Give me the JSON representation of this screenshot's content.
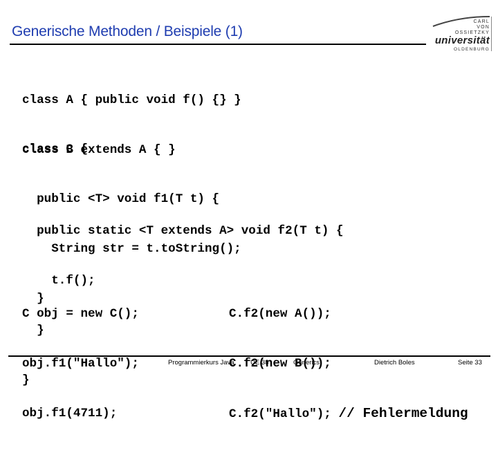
{
  "slide": {
    "title": "Generische Methoden / Beispiele (1)",
    "logo": {
      "line1": "CARL",
      "line2": "VON",
      "line3": "OSSIETZKY",
      "line4": "universität",
      "line5": "OLDENBURG"
    },
    "code": {
      "block1": [
        "class A { public void f() {} }",
        "class B extends A { }"
      ],
      "block2": [
        "class C {",
        "  public <T> void f1(T t) {",
        "    String str = t.toString();",
        "  }"
      ],
      "block3": [
        "  public static <T extends A> void f2(T t) {",
        "    t.f();",
        "  }",
        "}"
      ],
      "block4": [
        "C obj = new C();",
        "obj.f1(\"Hallo\");",
        "obj.f1(4711);"
      ],
      "block5": [
        "C.f2(new A());",
        "C.f2(new B());",
        "C.f2(\"Hallo\"); "
      ],
      "block5_comment": "// Fehlermeldung"
    },
    "footer": {
      "course": "Programmierkurs Java",
      "unit": "UE 38",
      "topic": "Generics",
      "author": "Dietrich Boles",
      "page": "Seite 33"
    },
    "colors": {
      "title": "#1f3db0",
      "text": "#000000",
      "background": "#ffffff"
    }
  }
}
